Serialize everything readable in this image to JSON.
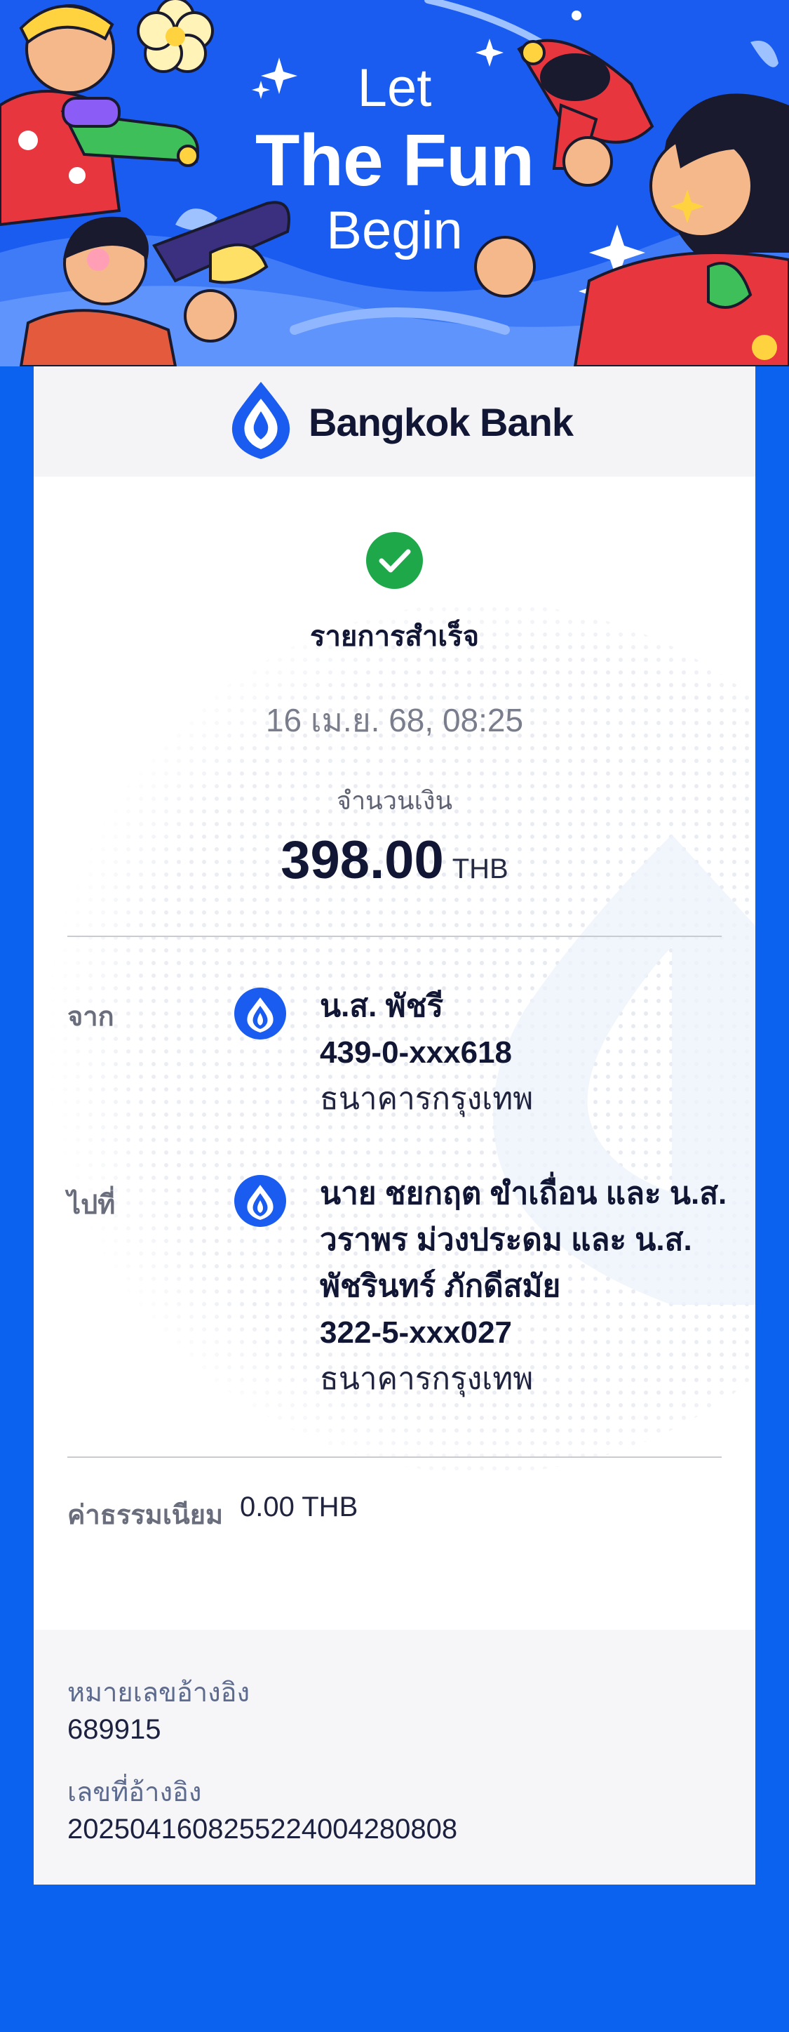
{
  "banner": {
    "line1": "Let",
    "line2": "The Fun",
    "line3": "Begin"
  },
  "brand": {
    "name": "Bangkok Bank",
    "color": "#1a5cf0"
  },
  "receipt": {
    "status": "รายการสำเร็จ",
    "datetime": "16 เม.ย. 68, 08:25",
    "amount_label": "จำนวนเงิน",
    "amount": "398.00",
    "currency": "THB",
    "from_label": "จาก",
    "from": {
      "name": "น.ส. พัชรี",
      "account": "439-0-xxx618",
      "bank": "ธนาคารกรุงเทพ"
    },
    "to_label": "ไปที่",
    "to": {
      "name_lines": [
        "นาย ชยกฤต ขำเถื่อน และ น.ส.",
        "วราพร ม่วงประดม และ น.ส.",
        "พัชรินทร์ ภักดีสมัย"
      ],
      "account": "322-5-xxx027",
      "bank": "ธนาคารกรุงเทพ"
    },
    "fee_label": "ค่าธรรมเนียม",
    "fee": "0.00 THB",
    "ref_no_label": "หมายเลขอ้างอิง",
    "ref_no": "689915",
    "ref_id_label": "เลขที่อ้างอิง",
    "ref_id": "2025041608255224004280808"
  },
  "colors": {
    "page_bg": "#0b62ee",
    "success": "#1ea84a",
    "text_dark": "#111634"
  },
  "icons": [
    "success-check-icon",
    "bangkok-bank-logo-icon"
  ]
}
